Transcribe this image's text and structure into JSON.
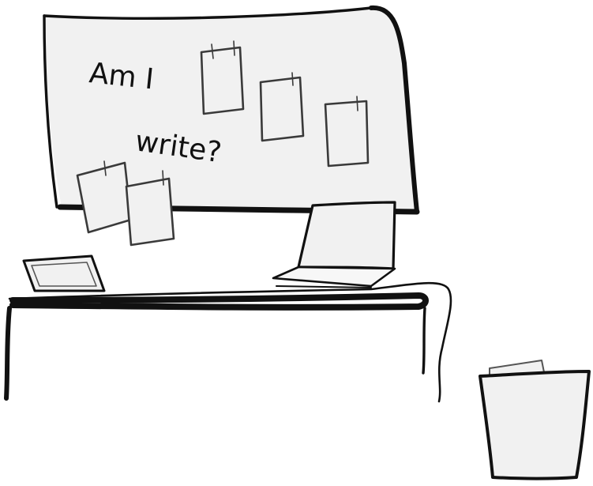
{
  "whiteboard": {
    "line1": "Am I",
    "line2": "write?"
  },
  "colors": {
    "ink": "#111111",
    "paper_fill": "#f1f1f1",
    "board_fill": "#f1f1f1",
    "background": "#ffffff"
  }
}
